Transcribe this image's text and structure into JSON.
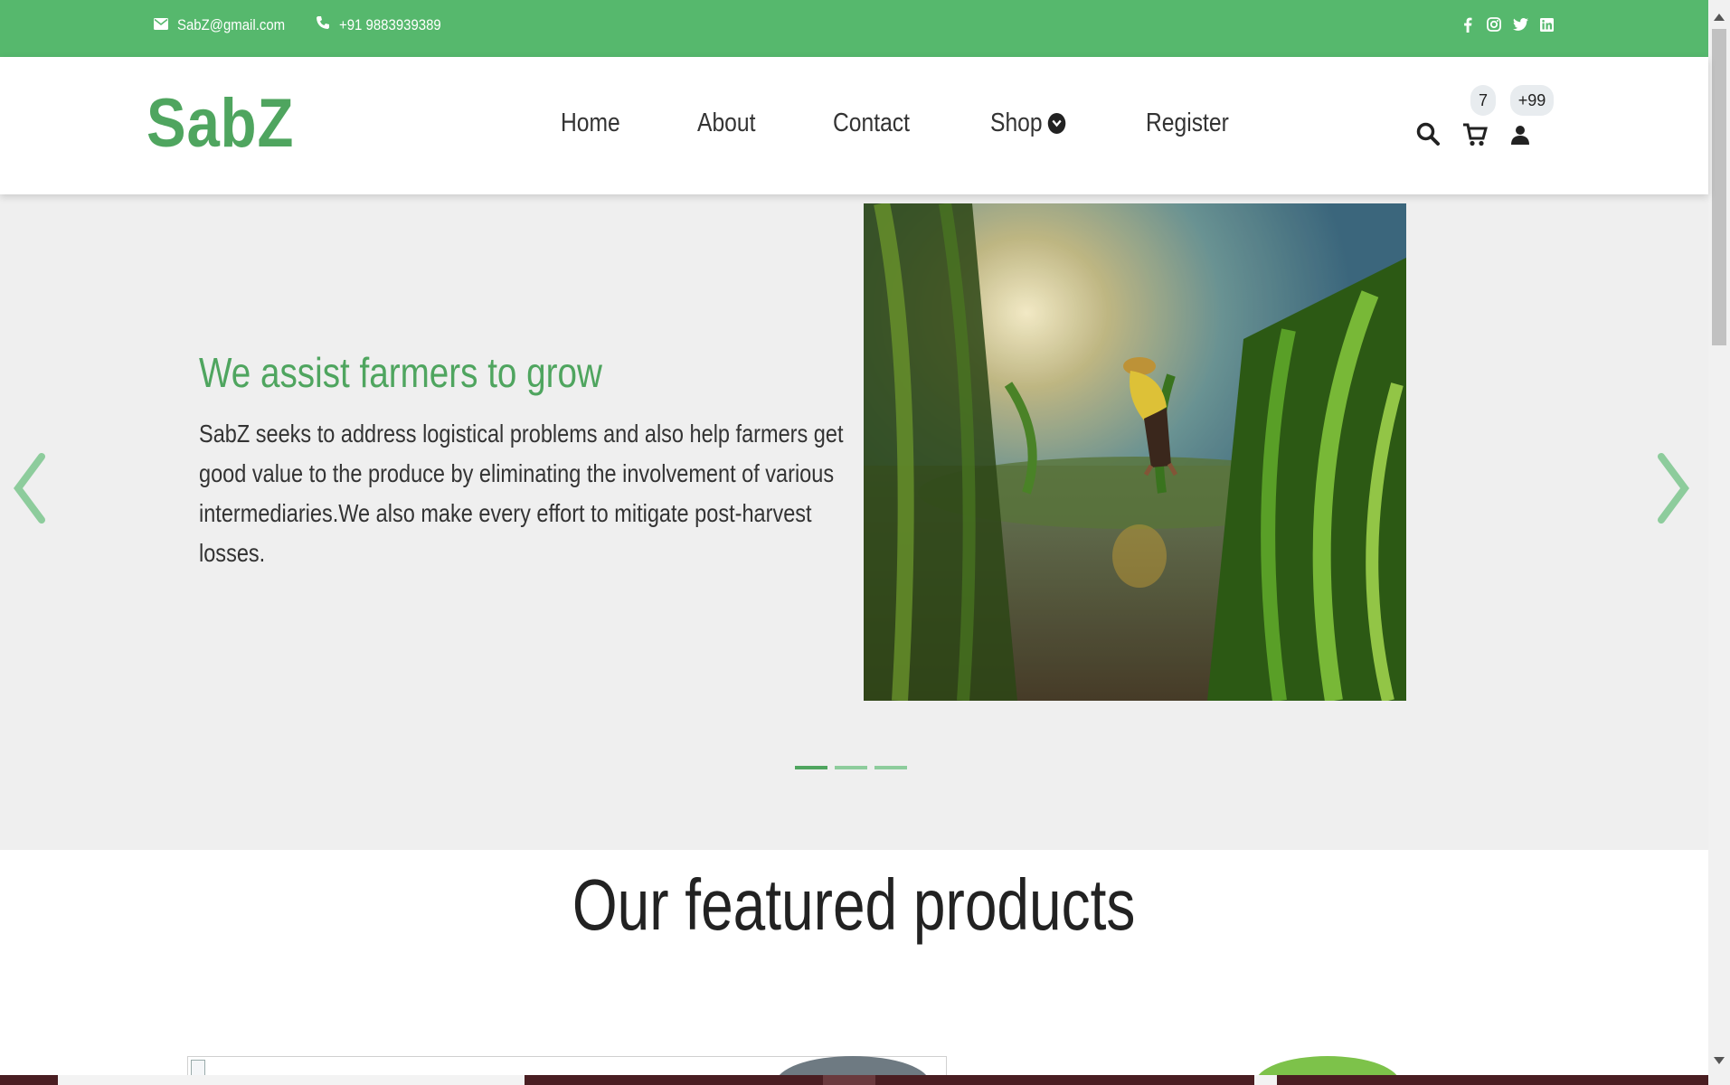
{
  "topbar": {
    "email": "SabZ@gmail.com",
    "phone": "+91 9883939389",
    "social_icons": [
      "facebook-icon",
      "instagram-icon",
      "twitter-icon",
      "linkedin-icon"
    ]
  },
  "navbar": {
    "logo": "SabZ",
    "links": [
      {
        "label": "Home"
      },
      {
        "label": "About"
      },
      {
        "label": "Contact"
      },
      {
        "label": "Shop",
        "has_dropdown": true
      },
      {
        "label": "Register"
      }
    ],
    "cart_count": "7",
    "user_badge": "+99"
  },
  "hero": {
    "title": "We assist farmers to grow",
    "text": "SabZ seeks to address logistical problems and also help farmers get good value to the produce by eliminating the involvement of various intermediaries.We also make every effort to mitigate post-harvest losses.",
    "image_description": "farmer-in-paddy-field",
    "active_slide": 1,
    "slide_count": 3
  },
  "featured": {
    "title": "Our featured products"
  },
  "colors": {
    "primary_green": "#56b86d",
    "logo_green": "#4fa55f",
    "hero_bg": "#efefef"
  }
}
